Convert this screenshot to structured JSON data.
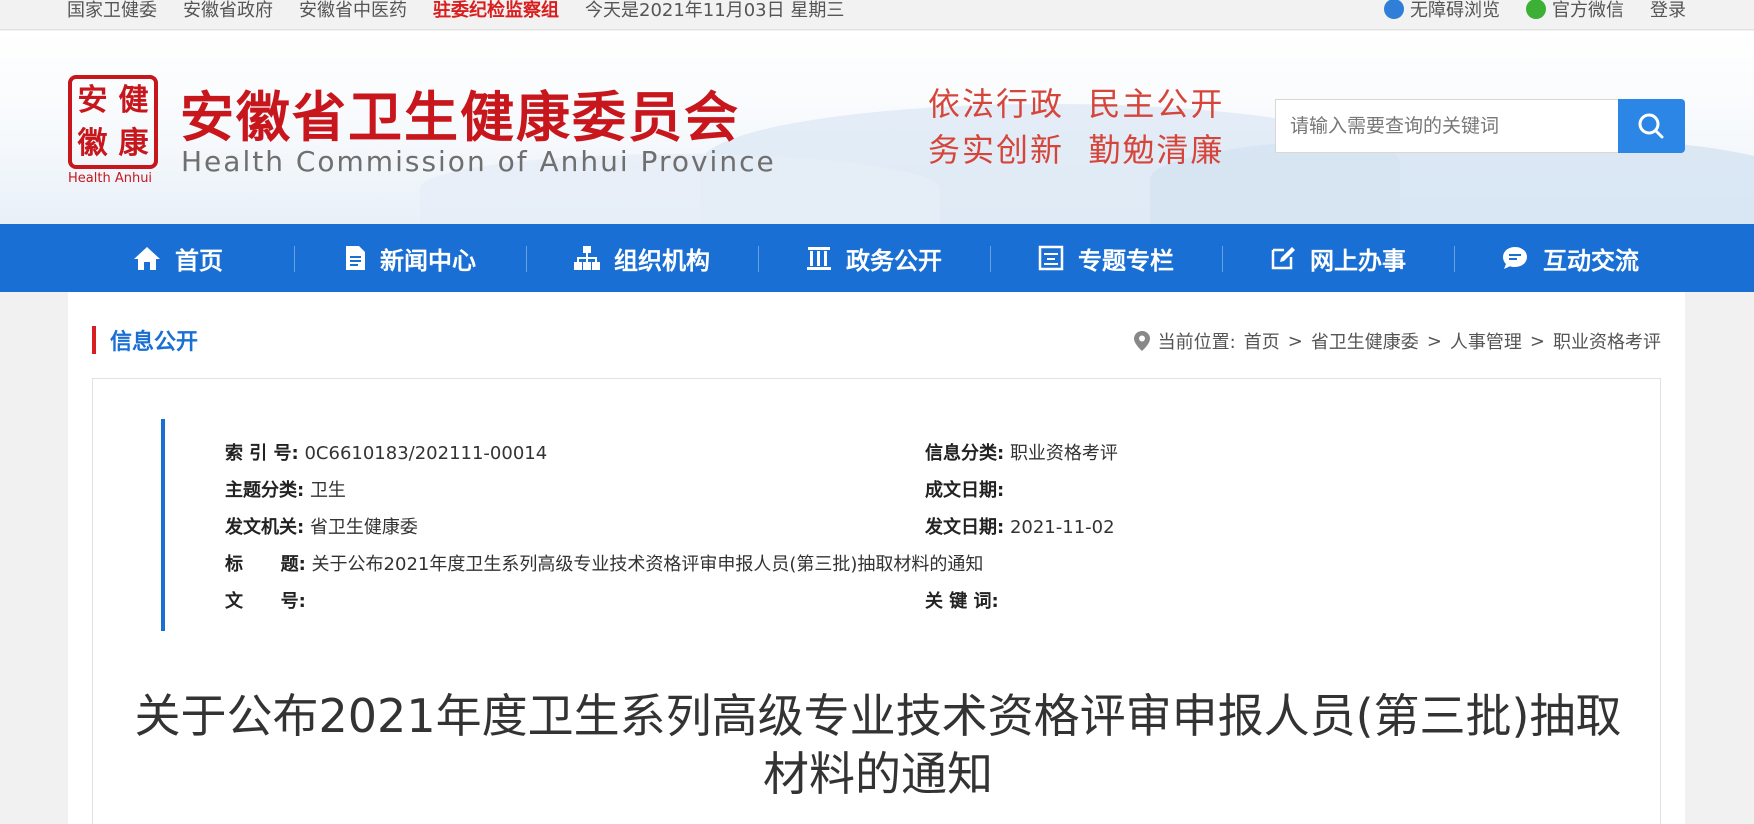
{
  "topbar": {
    "links": [
      "国家卫健委",
      "安徽省政府",
      "安徽省中医药"
    ],
    "highlight": "驻委纪检监察组",
    "date": "今天是2021年11月03日 星期三",
    "accessibility": "无障碍浏览",
    "wechat": "官方微信",
    "login": "登录"
  },
  "header": {
    "seal_chars": [
      "安",
      "健",
      "徽",
      "康"
    ],
    "seal_en": "Health Anhui",
    "title": "安徽省卫生健康委员会",
    "subtitle": "Health Commission of Anhui Province",
    "slogan_line1": "依法行政  民主公开",
    "slogan_line2": "务实创新  勤勉清廉",
    "search_placeholder": "请输入需要查询的关键词"
  },
  "nav": {
    "items": [
      {
        "label": "首页",
        "icon": "home-icon"
      },
      {
        "label": "新闻中心",
        "icon": "document-icon"
      },
      {
        "label": "组织机构",
        "icon": "org-chart-icon"
      },
      {
        "label": "政务公开",
        "icon": "building-icon"
      },
      {
        "label": "专题专栏",
        "icon": "board-icon"
      },
      {
        "label": "网上办事",
        "icon": "edit-icon"
      },
      {
        "label": "互动交流",
        "icon": "chat-icon"
      }
    ]
  },
  "section": {
    "title": "信息公开",
    "breadcrumb_prefix": "当前位置:",
    "breadcrumb": [
      "首页",
      "省卫生健康委",
      "人事管理",
      "职业资格考评"
    ]
  },
  "meta": {
    "index_label": "索 引 号:",
    "index_value": "0C6610183/202111-00014",
    "category_label": "信息分类:",
    "category_value": "职业资格考评",
    "topic_label": "主题分类:",
    "topic_value": "卫生",
    "written_label": "成文日期:",
    "written_value": "",
    "issuer_label": "发文机关:",
    "issuer_value": "省卫生健康委",
    "issue_date_label": "发文日期:",
    "issue_date_value": "2021-11-02",
    "title_label": "标      题:",
    "title_value": "关于公布2021年度卫生系列高级专业技术资格评审申报人员(第三批)抽取材料的通知",
    "docno_label": "文      号:",
    "docno_value": "",
    "keywords_label": "关 键 词:",
    "keywords_value": ""
  },
  "document": {
    "title": "关于公布2021年度卫生系列高级专业技术资格评审申报人员(第三批)抽取材料的通知"
  },
  "colors": {
    "brand_red": "#c8161d",
    "nav_blue": "#1a6fd4",
    "search_blue": "#2b86e5"
  }
}
